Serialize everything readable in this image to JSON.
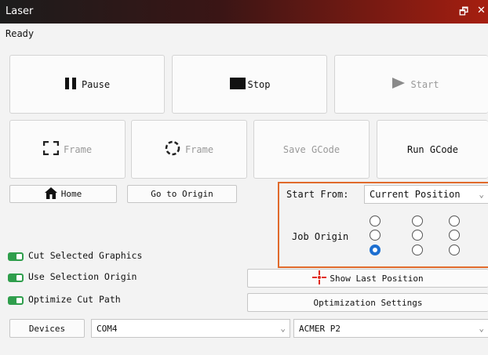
{
  "window": {
    "title": "Laser",
    "restore_glyph": "🗗",
    "close_glyph": "✕"
  },
  "status": "Ready",
  "controls": {
    "pause": "Pause",
    "stop": "Stop",
    "start": "Start"
  },
  "frames": {
    "frame_rect": "Frame",
    "frame_circle": "Frame",
    "save_gcode": "Save GCode",
    "run_gcode": "Run GCode"
  },
  "nav": {
    "home": "Home",
    "go_origin": "Go to Origin"
  },
  "start_from": {
    "label": "Start From:",
    "value": "Current Position"
  },
  "job_origin": {
    "label": "Job Origin",
    "selected_index": 6
  },
  "toggles": {
    "cut_selected": "Cut Selected Graphics",
    "use_selection_origin": "Use Selection Origin",
    "optimize_cut_path": "Optimize Cut Path"
  },
  "buttons": {
    "show_last_position": "Show Last Position",
    "optimization_settings": "Optimization Settings"
  },
  "devices": {
    "label": "Devices",
    "port": "COM4",
    "machine": "ACMER P2"
  },
  "colors": {
    "accent": "#e06a2b",
    "toggle_on": "#2f9e4c",
    "radio_selected": "#1d6fd0"
  }
}
